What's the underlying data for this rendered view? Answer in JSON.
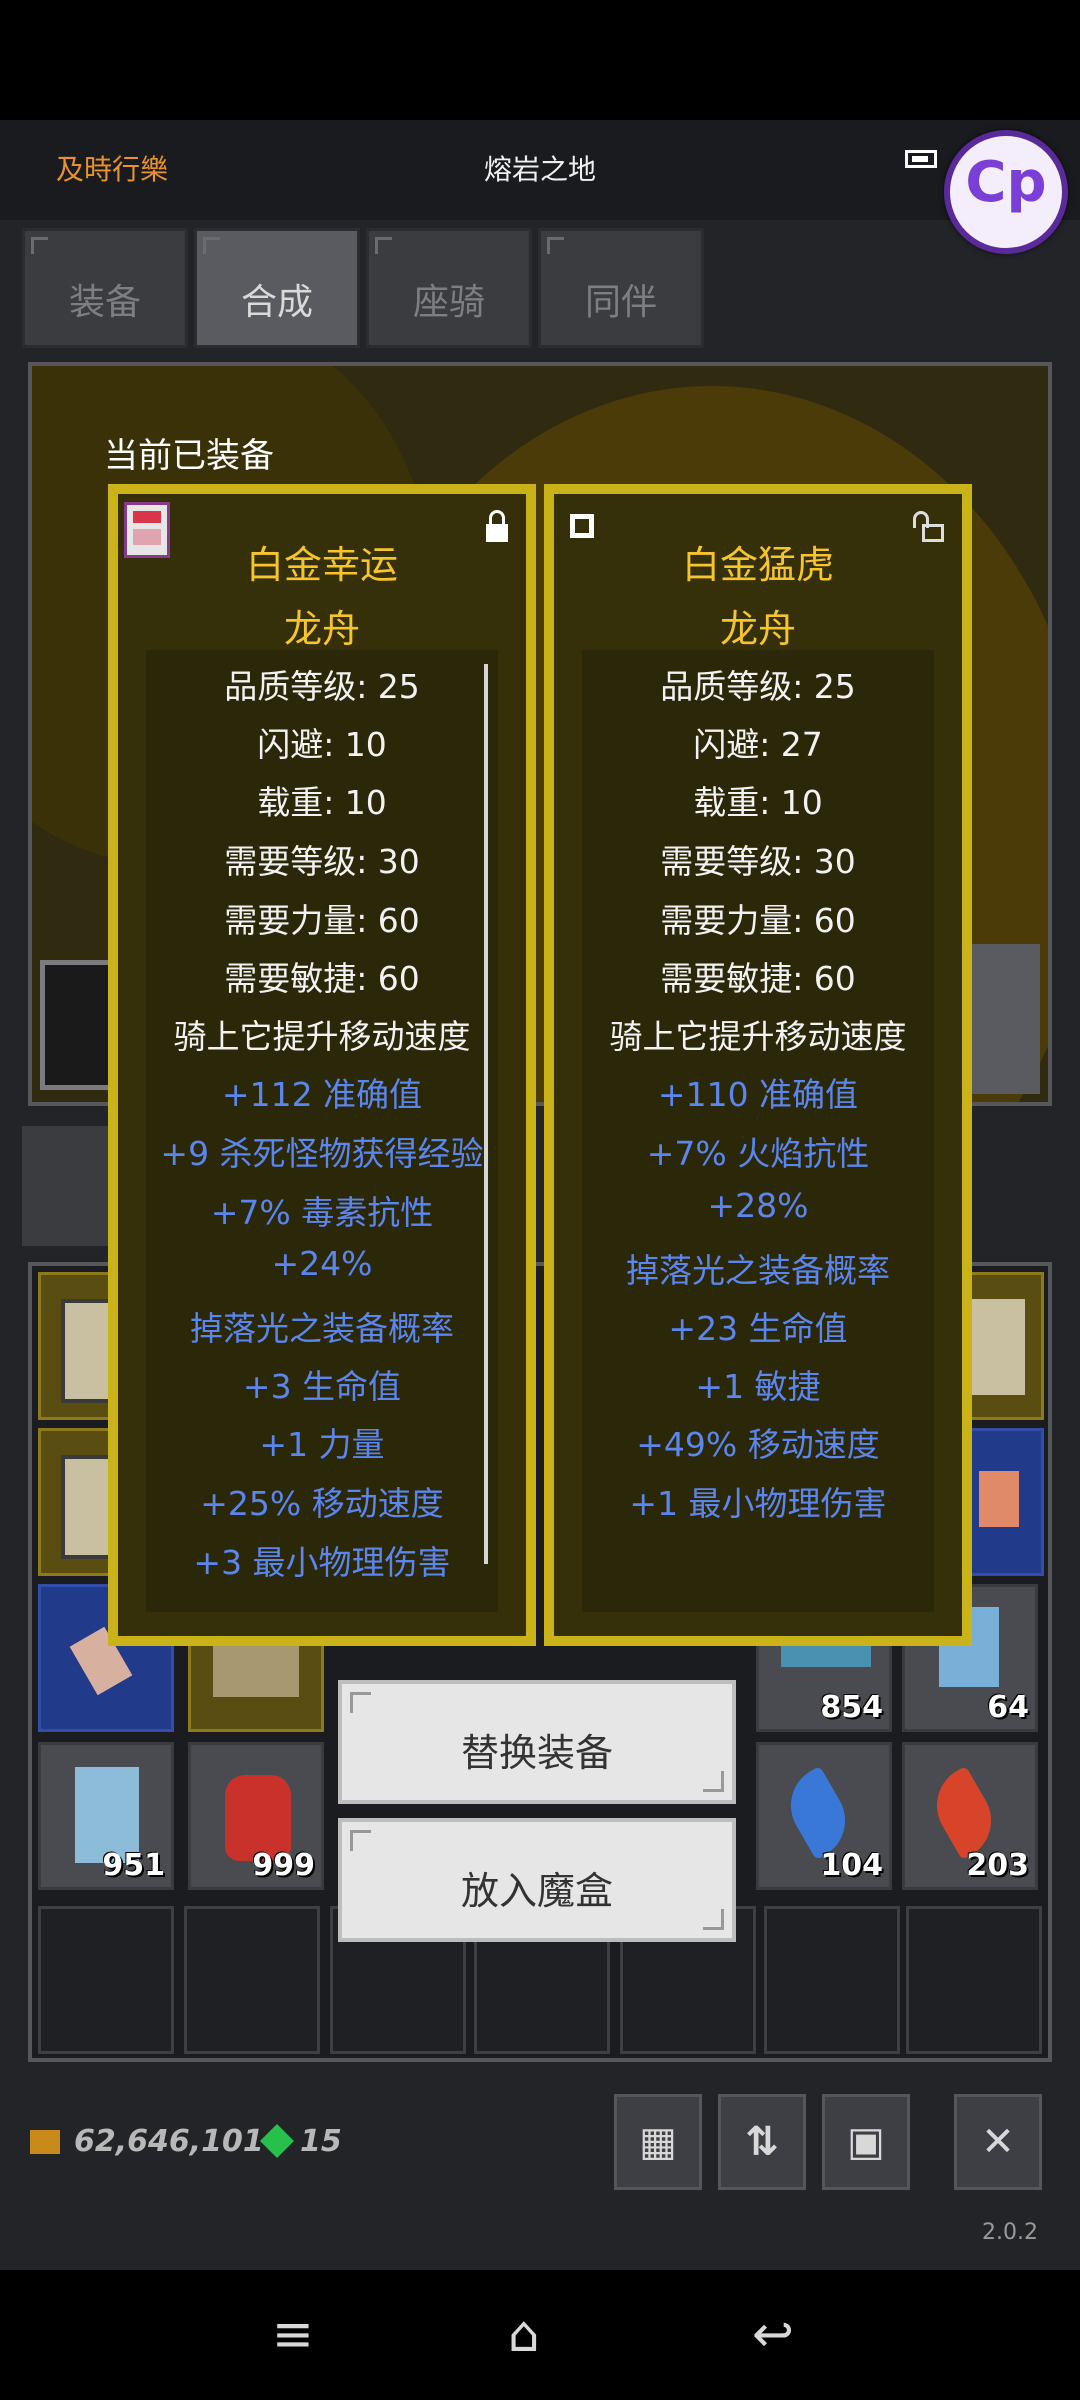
{
  "header": {
    "left_label": "及時行樂",
    "location": "熔岩之地",
    "logo_text": "Cp"
  },
  "tabs": [
    "装备",
    "合成",
    "座骑",
    "同伴"
  ],
  "active_tab": "合成",
  "equipped_label": "当前已装备",
  "panels": [
    {
      "name_line1": "白金幸运",
      "name_line2": "龙舟",
      "locked": true,
      "stats_white": [
        "品质等级: 25",
        "闪避: 10",
        "载重: 10",
        "需要等级: 30",
        "需要力量: 60",
        "需要敏捷: 60",
        "骑上它提升移动速度"
      ],
      "stats_blue": [
        "+112 准确值",
        "+9 杀死怪物获得经验",
        "+7% 毒素抗性",
        "+24%",
        "掉落光之装备概率",
        "+3 生命值",
        "+1 力量",
        "+25% 移动速度",
        "+3 最小物理伤害"
      ]
    },
    {
      "name_line1": "白金猛虎",
      "name_line2": "龙舟",
      "locked": false,
      "stats_white": [
        "品质等级: 25",
        "闪避: 27",
        "载重: 10",
        "需要等级: 30",
        "需要力量: 60",
        "需要敏捷: 60",
        "骑上它提升移动速度"
      ],
      "stats_blue": [
        "+110 准确值",
        "+7% 火焰抗性",
        "+28%",
        "掉落光之装备概率",
        "+23 生命值",
        "+1 敏捷",
        "+49% 移动速度",
        "+1 最小物理伤害"
      ]
    }
  ],
  "buttons": {
    "replace": "替换装备",
    "put_in_box": "放入魔盒"
  },
  "inventory_counts": {
    "fish": "854",
    "scroll_top": "64",
    "scroll": "951",
    "potion": "999",
    "blue_feather": "104",
    "red_feather": "203"
  },
  "footer": {
    "gold": "62,646,101",
    "gems": "15",
    "version": "2.0.2"
  },
  "colors": {
    "panel_border": "#c9b319",
    "item_name": "#f6c52a",
    "bonus_stat": "#5b86ee"
  }
}
